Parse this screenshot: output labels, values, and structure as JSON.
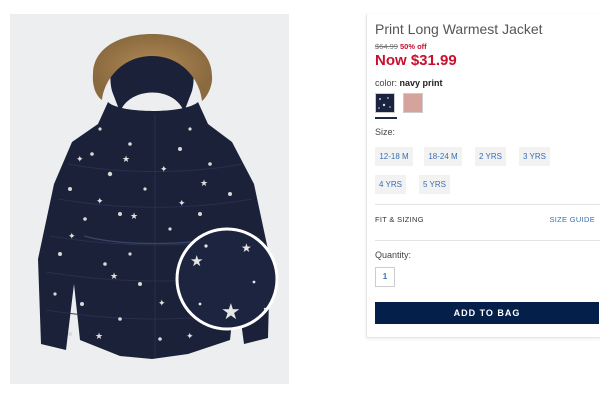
{
  "product": {
    "title": "Print Long Warmest Jacket",
    "original_price": "$64.99",
    "discount": "50% off",
    "now_price": "Now $31.99"
  },
  "color": {
    "label": "color:",
    "selected": "navy print",
    "swatches": [
      {
        "name": "navy print",
        "hex": "#1a2340"
      },
      {
        "name": "pink",
        "hex": "#d6a39c"
      }
    ]
  },
  "sizes": {
    "label": "Size:",
    "options": [
      "12-18 M",
      "18-24 M",
      "2 YRS",
      "3 YRS",
      "4 YRS",
      "5 YRS"
    ]
  },
  "fit": {
    "label": "FIT & SIZING",
    "guide": "SIZE GUIDE"
  },
  "quantity": {
    "label": "Quantity:",
    "value": "1"
  },
  "cta": {
    "add_to_bag": "ADD TO BAG"
  },
  "colors": {
    "price_red": "#c8102e",
    "link_blue": "#3a6fb0",
    "button_navy": "#041f4a"
  }
}
